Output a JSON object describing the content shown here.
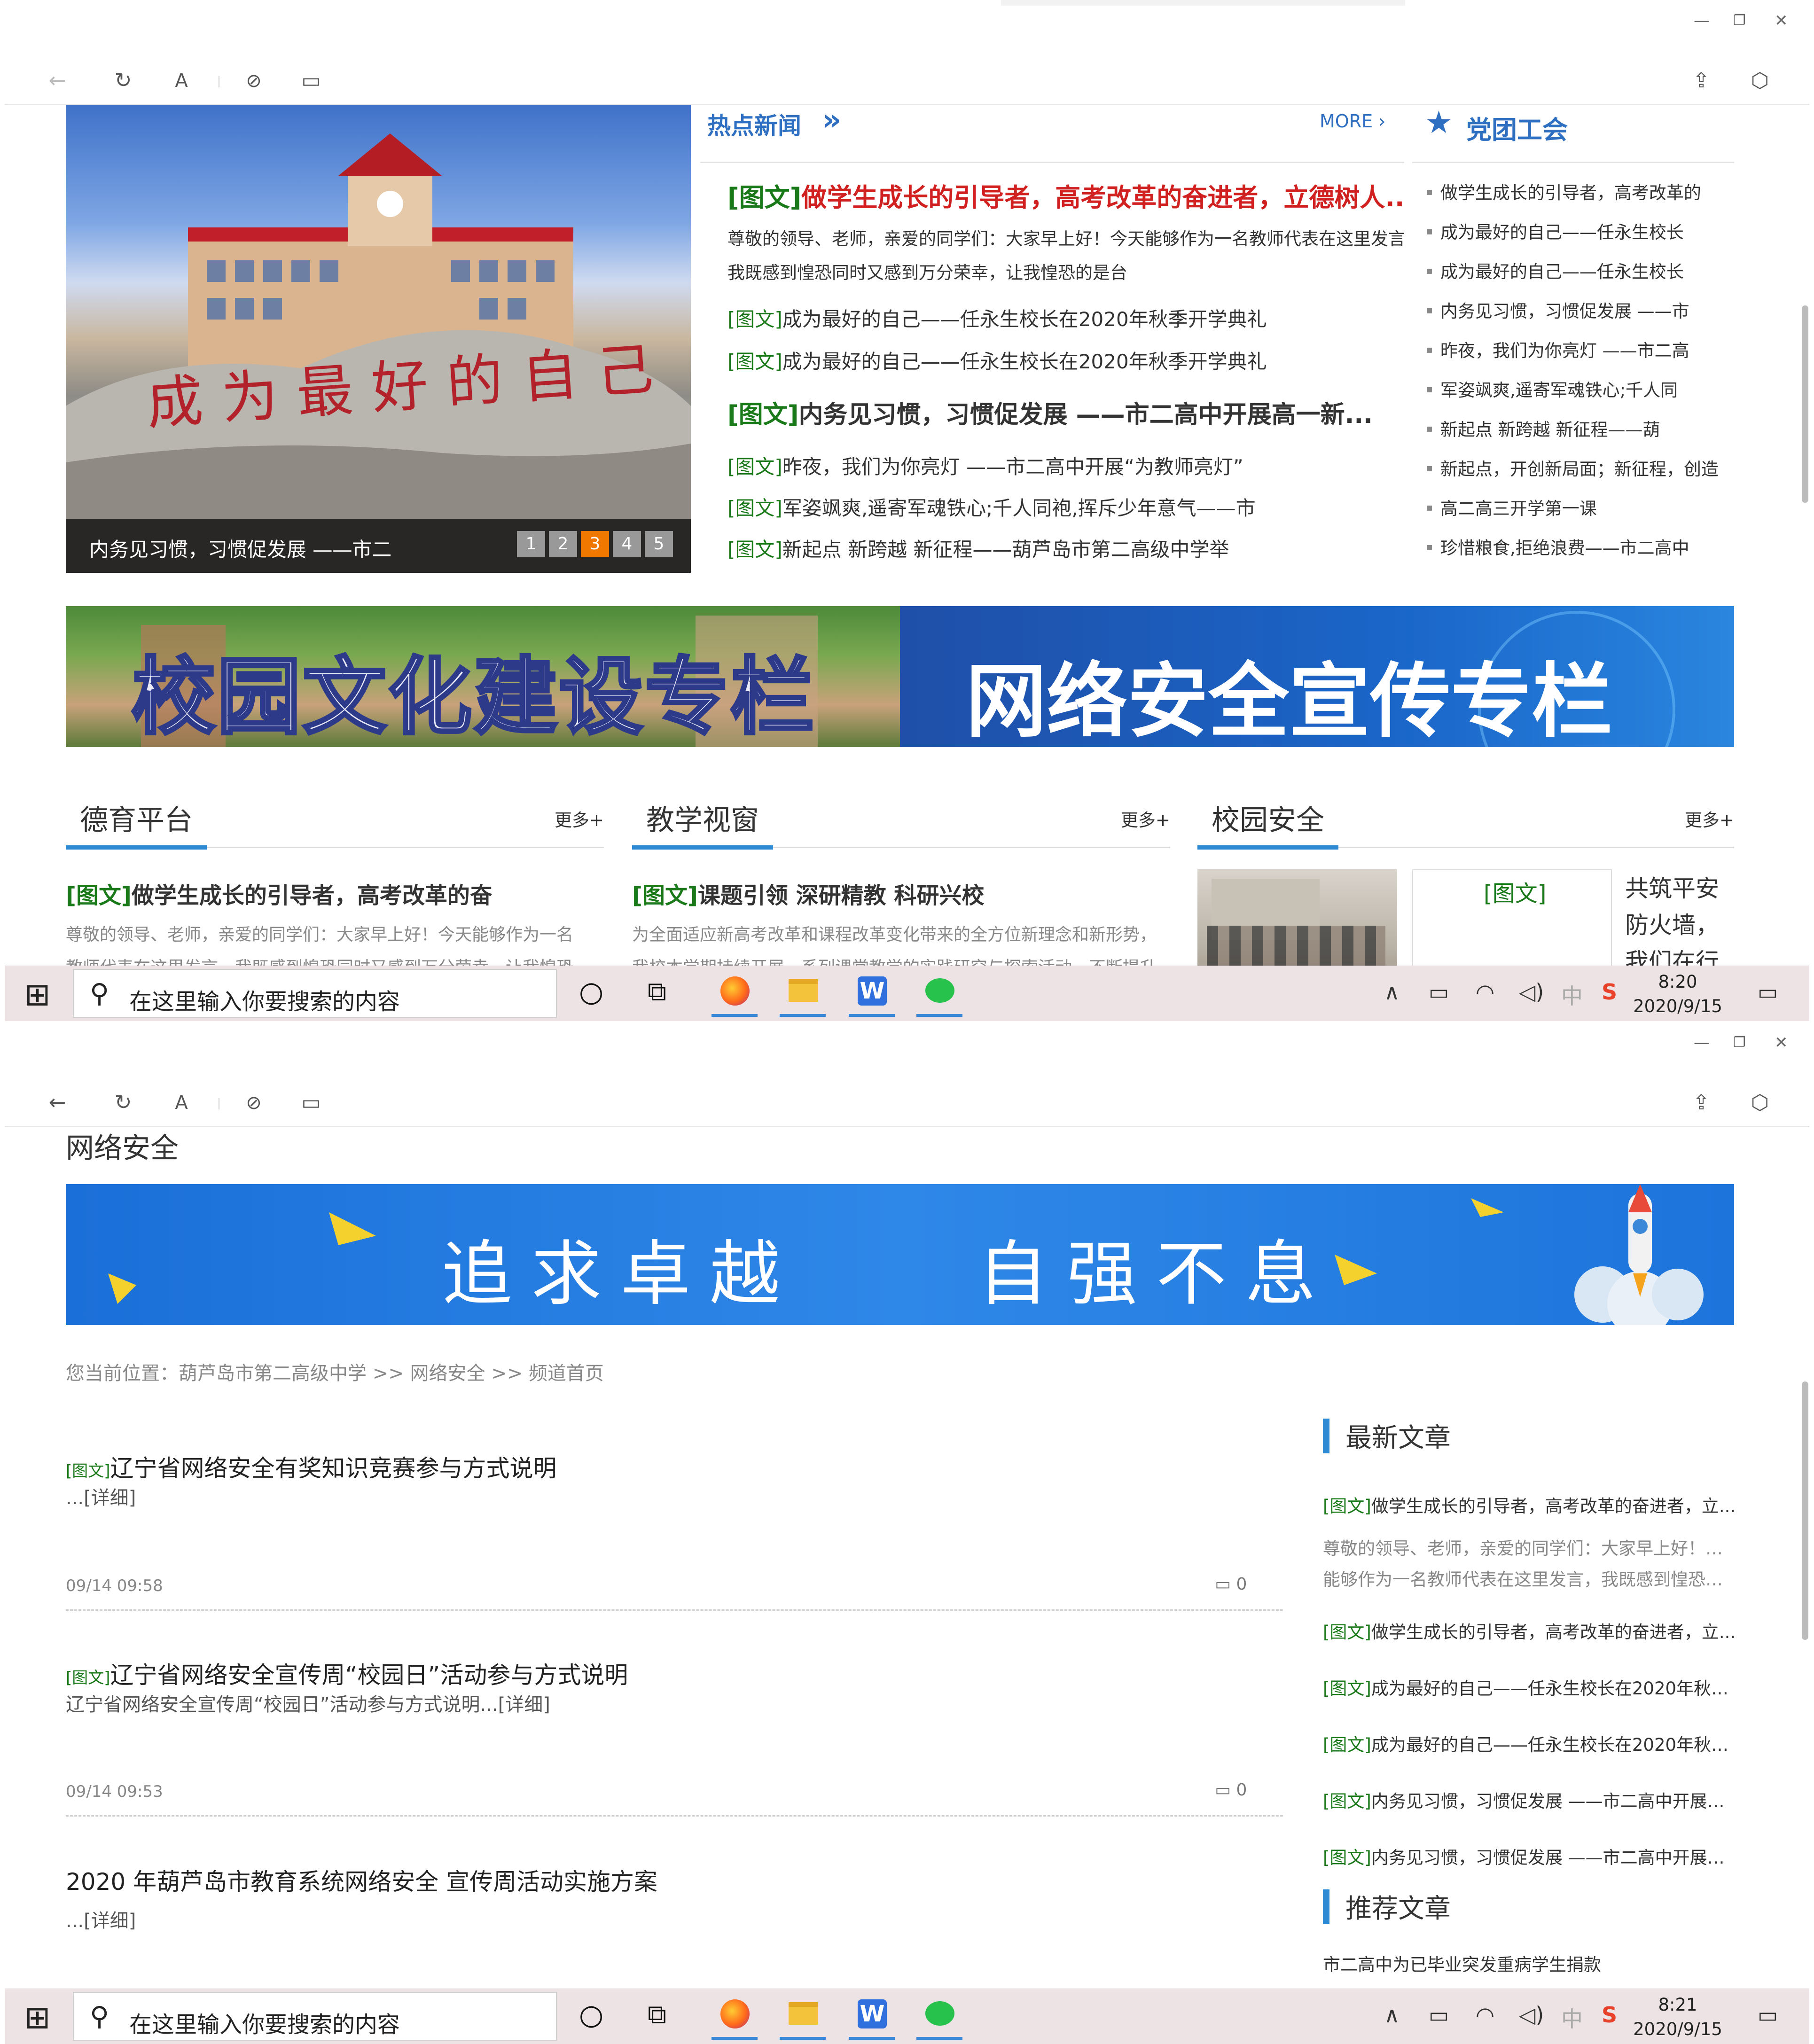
{
  "colors": {
    "accent": "#2e8bd3",
    "hot_title": "#2e6fc2",
    "green": "#1a7a1a",
    "red": "#d12020",
    "orange_page": "#f07800",
    "taskbar": "#ede3e4"
  },
  "window": {
    "minimize": "—",
    "restore": "❐",
    "close": "✕"
  },
  "toolbar": {
    "back": "←",
    "refresh": "↻",
    "font": "A",
    "link": "⊘",
    "reader": "▭",
    "share": "⇪",
    "extensions": "⬡"
  },
  "screen1": {
    "slider": {
      "caption": "内务见习惯，习惯促发展 ——市二",
      "pages": [
        "1",
        "2",
        "3",
        "4",
        "5"
      ],
      "active_page": "3",
      "stone_text": "成为最好的自己"
    },
    "hot": {
      "title": "热点新闻",
      "arrows": "»",
      "more": "MORE ›",
      "headline_tag": "[图文]",
      "headline": "做学生成长的引导者，高考改革的奋进者，立德树人...",
      "summary1": "尊敬的领导、老师，亲爱的同学们：大家早上好！今天能够作为一名教师代表在这里发言，",
      "summary2": "我既感到惶恐同时又感到万分荣幸，让我惶恐的是台",
      "items": [
        {
          "tag": "[图文]",
          "text": "成为最好的自己——任永生校长在2020年秋季开学典礼"
        },
        {
          "tag": "[图文]",
          "text": "成为最好的自己——任永生校长在2020年秋季开学典礼"
        },
        {
          "tag": "[图文]",
          "text": "内务见习惯，习惯促发展 ——市二高中开展高一新..."
        },
        {
          "tag": "[图文]",
          "text": "昨夜，我们为你亮灯 ——市二高中开展“为教师亮灯”"
        },
        {
          "tag": "[图文]",
          "text": "军姿飒爽,遥寄军魂铁心;千人同袍,挥斥少年意气——市"
        },
        {
          "tag": "[图文]",
          "text": "新起点 新跨越 新征程——葫芦岛市第二高级中学举"
        }
      ]
    },
    "party": {
      "star": "★",
      "title": "党团工会",
      "items": [
        "做学生成长的引导者，高考改革的",
        "成为最好的自己——任永生校长",
        "成为最好的自己——任永生校长",
        "内务见习惯，习惯促发展 ——市",
        "昨夜，我们为你亮灯 ——市二高",
        "军姿飒爽,遥寄军魂铁心;千人同",
        "新起点 新跨越 新征程——葫",
        "新起点，开创新局面；新征程，创造",
        "高二高三开学第一课",
        "珍惜粮食,拒绝浪费——市二高中"
      ]
    },
    "banners": {
      "left": "校园文化建设专栏",
      "right": "网络安全宣传专栏"
    },
    "cols": [
      {
        "title": "德育平台",
        "more": "更多+",
        "tag": "[图文]",
        "headline": "做学生成长的引导者，高考改革的奋",
        "summary1": "尊敬的领导、老师，亲爱的同学们：大家早上好！今天能够作为一名",
        "summary2": "教师代表在这里发言，我既感到惶恐同时又感到万分荣幸，让我惶恐的是"
      },
      {
        "title": "教学视窗",
        "more": "更多+",
        "tag": "[图文]",
        "headline": "课题引领 深研精教 科研兴校",
        "summary1": "为全面适应新高考改革和课程改革变化带来的全方位新理念和新形势，",
        "summary2": "我校本学期持续开展一系列课堂教学的实践研究与探索活动，不断提升"
      },
      {
        "title": "校园安全",
        "more": "更多+",
        "tag": "[图文]",
        "text1": "共筑平安",
        "text2": "防火墙，",
        "text3": "我们在行"
      }
    ],
    "clock": {
      "time": "8:20",
      "date": "2020/9/15"
    }
  },
  "screen2": {
    "channel": "网络安全",
    "banner": {
      "left": "追求卓越",
      "right": "自强不息"
    },
    "breadcrumb": "您当前位置：葫芦岛市第二高级中学 >> 网络安全 >> 频道首页",
    "articles": [
      {
        "tag": "[图文]",
        "title": "辽宁省网络安全有奖知识竞赛参与方式说明",
        "summary": "...[详细]",
        "time": "09/14 09:58",
        "comments": "0"
      },
      {
        "tag": "[图文]",
        "title": "辽宁省网络安全宣传周“校园日”活动参与方式说明",
        "summary": "辽宁省网络安全宣传周“校园日”活动参与方式说明...[详细]",
        "time": "09/14 09:53",
        "comments": "0"
      },
      {
        "tag": "",
        "title": "2020 年葫芦岛市教育系统网络安全 宣传周活动实施方案",
        "summary": "...[详细]"
      }
    ],
    "latest": {
      "title": "最新文章",
      "first": {
        "tag": "[图文]",
        "text": "做学生成长的引导者，高考改革的奋进者，立..."
      },
      "summary1": "尊敬的领导、老师，亲爱的同学们：大家早上好！今天",
      "summary2": "能够作为一名教师代表在这里发言，我既感到惶恐同时",
      "items": [
        {
          "tag": "[图文]",
          "text": "做学生成长的引导者，高考改革的奋进者，立..."
        },
        {
          "tag": "[图文]",
          "text": "成为最好的自己——任永生校长在2020年秋季..."
        },
        {
          "tag": "[图文]",
          "text": "成为最好的自己——任永生校长在2020年秋季..."
        },
        {
          "tag": "[图文]",
          "text": "内务见习惯，习惯促发展 ——市二高中开展高..."
        },
        {
          "tag": "[图文]",
          "text": "内务见习惯，习惯促发展 ——市二高中开展高..."
        }
      ]
    },
    "recommend": {
      "title": "推荐文章",
      "items": [
        "市二高中为已毕业突发重病学生捐款"
      ]
    },
    "clock": {
      "time": "8:21",
      "date": "2020/9/15"
    }
  },
  "taskbar": {
    "start": "⊞",
    "search_icon": "⚲",
    "search_placeholder": "在这里输入你要搜索的内容",
    "cortana": "○",
    "taskview": "⧉",
    "tray_chevron": "∧",
    "ime": "中",
    "notification": "▭"
  }
}
